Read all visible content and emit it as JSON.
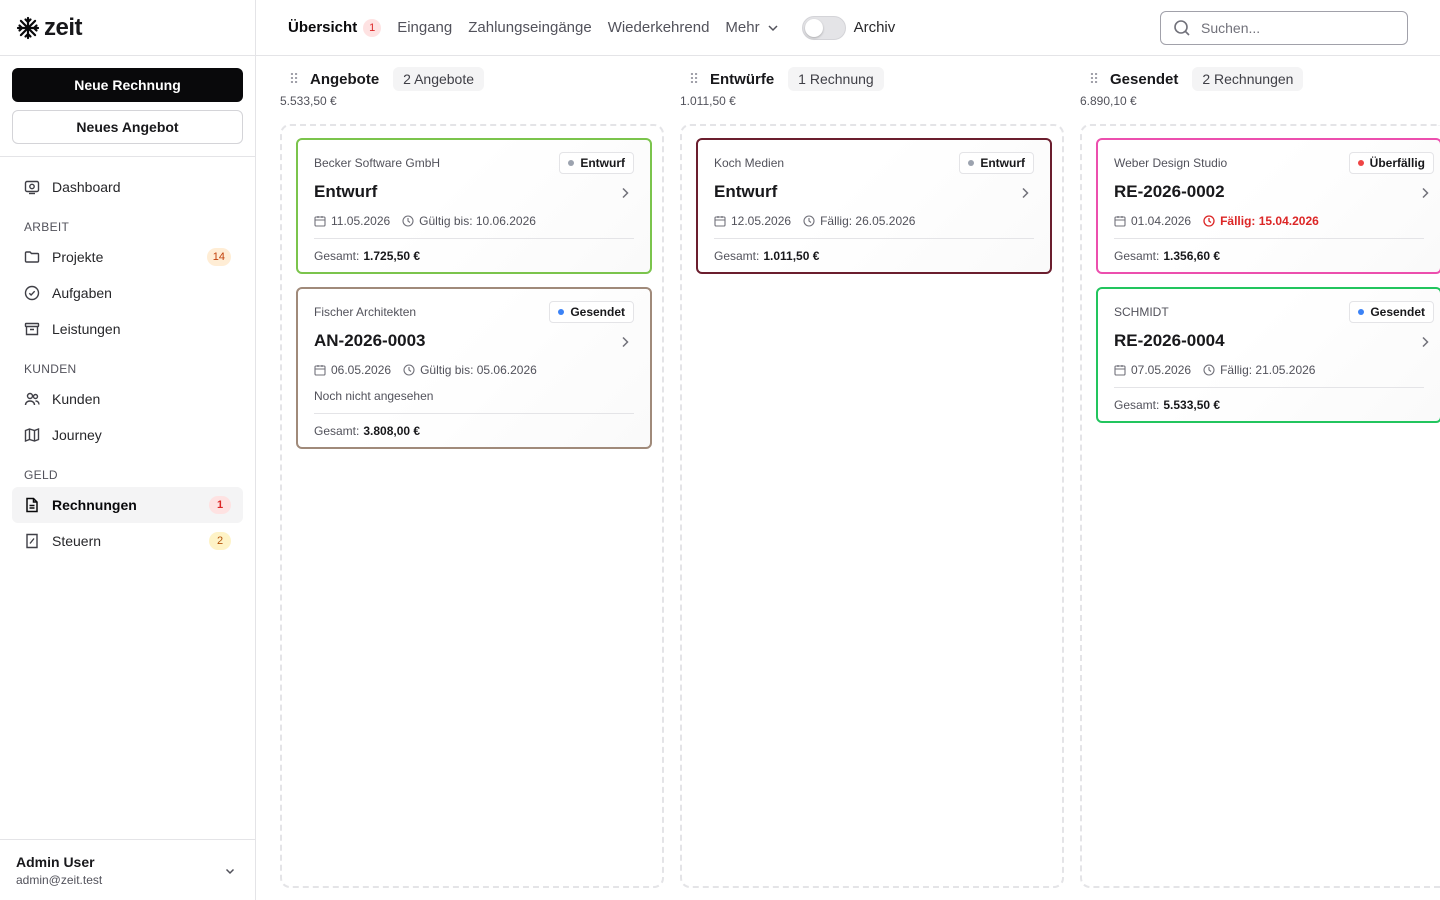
{
  "app": {
    "name": "zeit"
  },
  "sidebar": {
    "new_invoice": "Neue Rechnung",
    "new_offer": "Neues Angebot",
    "dashboard": "Dashboard",
    "sections": {
      "work": "ARBEIT",
      "customers": "KUNDEN",
      "money": "GELD"
    },
    "items": {
      "projekte": {
        "label": "Projekte",
        "count": "14"
      },
      "aufgaben": {
        "label": "Aufgaben"
      },
      "leistungen": {
        "label": "Leistungen"
      },
      "kunden": {
        "label": "Kunden"
      },
      "journey": {
        "label": "Journey"
      },
      "rechnungen": {
        "label": "Rechnungen",
        "count": "1"
      },
      "steuern": {
        "label": "Steuern",
        "count": "2"
      }
    },
    "user": {
      "name": "Admin User",
      "email": "admin@zeit.test"
    }
  },
  "topbar": {
    "tabs": [
      {
        "label": "Übersicht",
        "badge": "1"
      },
      {
        "label": "Eingang"
      },
      {
        "label": "Zahlungseingänge"
      },
      {
        "label": "Wiederkehrend"
      },
      {
        "label": "Mehr"
      }
    ],
    "archive_label": "Archiv",
    "archive_on": false,
    "search_placeholder": "Suchen..."
  },
  "columns": [
    {
      "title": "Angebote",
      "count_label": "2 Angebote",
      "total": "5.533,50 €",
      "cards": [
        {
          "client": "Becker Software GmbH",
          "status": "Entwurf",
          "status_color": "#9ca3af",
          "border": "#7bc44c",
          "title": "Entwurf",
          "date": "11.05.2026",
          "due": "Gültig bis: 10.06.2026",
          "total_label": "Gesamt:",
          "total": "1.725,50 €"
        },
        {
          "client": "Fischer Architekten",
          "status": "Gesendet",
          "status_color": "#3b82f6",
          "border": "#a08a7a",
          "title": "AN-2026-0003",
          "date": "06.05.2026",
          "due": "Gültig bis: 05.06.2026",
          "note": "Noch nicht angesehen",
          "total_label": "Gesamt:",
          "total": "3.808,00 €"
        }
      ]
    },
    {
      "title": "Entwürfe",
      "count_label": "1 Rechnung",
      "total": "1.011,50 €",
      "cards": [
        {
          "client": "Koch Medien",
          "status": "Entwurf",
          "status_color": "#9ca3af",
          "border": "#6b1e2e",
          "title": "Entwurf",
          "date": "12.05.2026",
          "due": "Fällig: 26.05.2026",
          "total_label": "Gesamt:",
          "total": "1.011,50 €"
        }
      ]
    },
    {
      "title": "Gesendet",
      "count_label": "2 Rechnungen",
      "total": "6.890,10 €",
      "cards": [
        {
          "client": "Weber Design Studio",
          "status": "Überfällig",
          "status_color": "#ef4444",
          "border": "#ec4fae",
          "title": "RE-2026-0002",
          "date": "01.04.2026",
          "due": "Fällig: 15.04.2026",
          "due_overdue": true,
          "total_label": "Gesamt:",
          "total": "1.356,60 €"
        },
        {
          "client": "SCHMIDT",
          "status": "Gesendet",
          "status_color": "#3b82f6",
          "border": "#22c55e",
          "title": "RE-2026-0004",
          "date": "07.05.2026",
          "due": "Fällig: 21.05.2026",
          "total_label": "Gesamt:",
          "total": "5.533,50 €"
        }
      ]
    }
  ]
}
